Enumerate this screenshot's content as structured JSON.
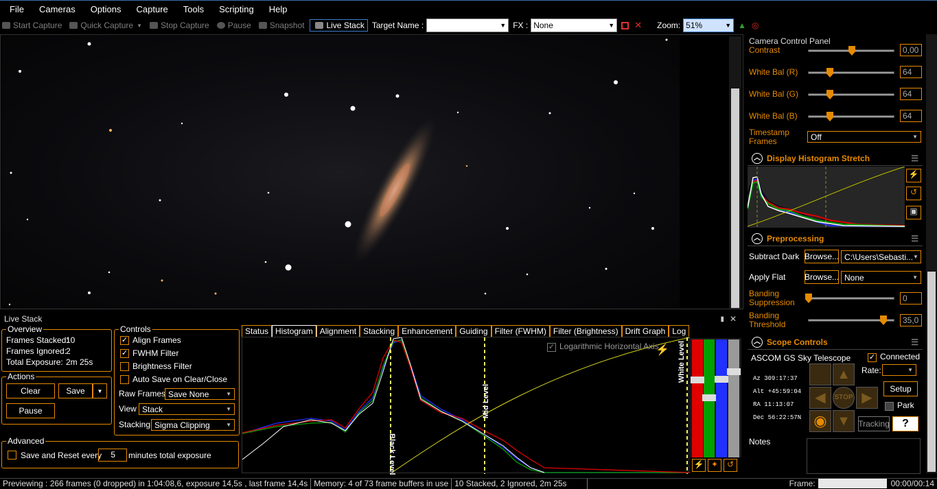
{
  "menu": [
    "File",
    "Cameras",
    "Options",
    "Capture",
    "Tools",
    "Scripting",
    "Help"
  ],
  "toolbar": {
    "start_capture": "Start Capture",
    "quick_capture": "Quick Capture",
    "stop_capture": "Stop Capture",
    "pause": "Pause",
    "snapshot": "Snapshot",
    "live_stack": "Live Stack",
    "target_label": "Target Name :",
    "target_value": "",
    "fx_label": "FX :",
    "fx_value": "None",
    "zoom_label": "Zoom:",
    "zoom_value": "51%"
  },
  "live_stack": {
    "title": "Live Stack",
    "overview": {
      "title": "Overview",
      "frames_stacked_label": "Frames Stacked:",
      "frames_stacked": "10",
      "frames_ignored_label": "Frames Ignored:",
      "frames_ignored": "2",
      "total_exposure_label": "Total Exposure:",
      "total_exposure": "2m 25s"
    },
    "actions": {
      "title": "Actions",
      "clear": "Clear",
      "save": "Save",
      "pause": "Pause"
    },
    "advanced": {
      "title": "Advanced",
      "save_reset_label": "Save and Reset every",
      "save_reset_value": "5",
      "save_reset_suffix": "minutes total exposure"
    },
    "controls": {
      "title": "Controls",
      "align": "Align Frames",
      "fwhm": "FWHM Filter",
      "brightness": "Brightness Filter",
      "autosave": "Auto Save on Clear/Close",
      "raw_label": "Raw Frames",
      "raw_value": "Save None",
      "view_label": "View",
      "view_value": "Stack",
      "stacking_label": "Stacking",
      "stacking_value": "Sigma Clipping"
    },
    "tabs": [
      "Status",
      "Histogram",
      "Alignment",
      "Stacking",
      "Enhancement",
      "Guiding",
      "Filter (FWHM)",
      "Filter (Brightness)",
      "Drift Graph",
      "Log"
    ],
    "active_tab": "Histogram",
    "hist": {
      "log_axis": "Logarithmic Horizontal Axis",
      "black_level": "Black Level",
      "mid_level": "Mid Level",
      "white_level": "White Level"
    }
  },
  "camera_panel": {
    "title": "Camera Control Panel",
    "contrast_label": "Contrast",
    "contrast_value": "0,00",
    "wb_r_label": "White Bal (R)",
    "wb_r_value": "64",
    "wb_g_label": "White Bal (G)",
    "wb_g_value": "64",
    "wb_b_label": "White Bal (B)",
    "wb_b_value": "64",
    "timestamp_label": "Timestamp Frames",
    "timestamp_value": "Off"
  },
  "display_hist": {
    "title": "Display Histogram Stretch"
  },
  "preprocessing": {
    "title": "Preprocessing",
    "subtract_dark": "Subtract Dark",
    "browse": "Browse...",
    "dark_path": "C:\\Users\\Sebasti...",
    "apply_flat": "Apply Flat",
    "flat_value": "None",
    "banding_supp": "Banding Suppression",
    "banding_supp_value": "0",
    "banding_thresh": "Banding Threshold",
    "banding_thresh_value": "35,0"
  },
  "scope": {
    "title": "Scope Controls",
    "mount": "ASCOM GS Sky Telescope",
    "connected": "Connected",
    "az": "Az  309:17:37",
    "alt": "Alt +45:59:04",
    "ra": "RA  11:13:07",
    "dec": "Dec 56:22:57N",
    "stop": "STOP",
    "rate": "Rate:",
    "setup": "Setup",
    "park": "Park",
    "tracking": "Tracking",
    "help": "?"
  },
  "notes": {
    "title": "Notes"
  },
  "status": {
    "preview": "Previewing : 266 frames (0 dropped) in 1:04:08,6, exposure 14,5s , last frame 14,4s",
    "memory": "Memory: 4 of 73 frame buffers in use",
    "stacked": "10 Stacked, 2 Ignored, 2m 25s",
    "frame_label": "Frame:",
    "time": "00:00/00:14"
  },
  "colors": {
    "accent": "#e68a00",
    "highlight": "#3e7fd0",
    "hist_red": "#e00000",
    "hist_green": "#00a000",
    "hist_blue": "#2030ff",
    "hist_curve": "#d8d820"
  }
}
